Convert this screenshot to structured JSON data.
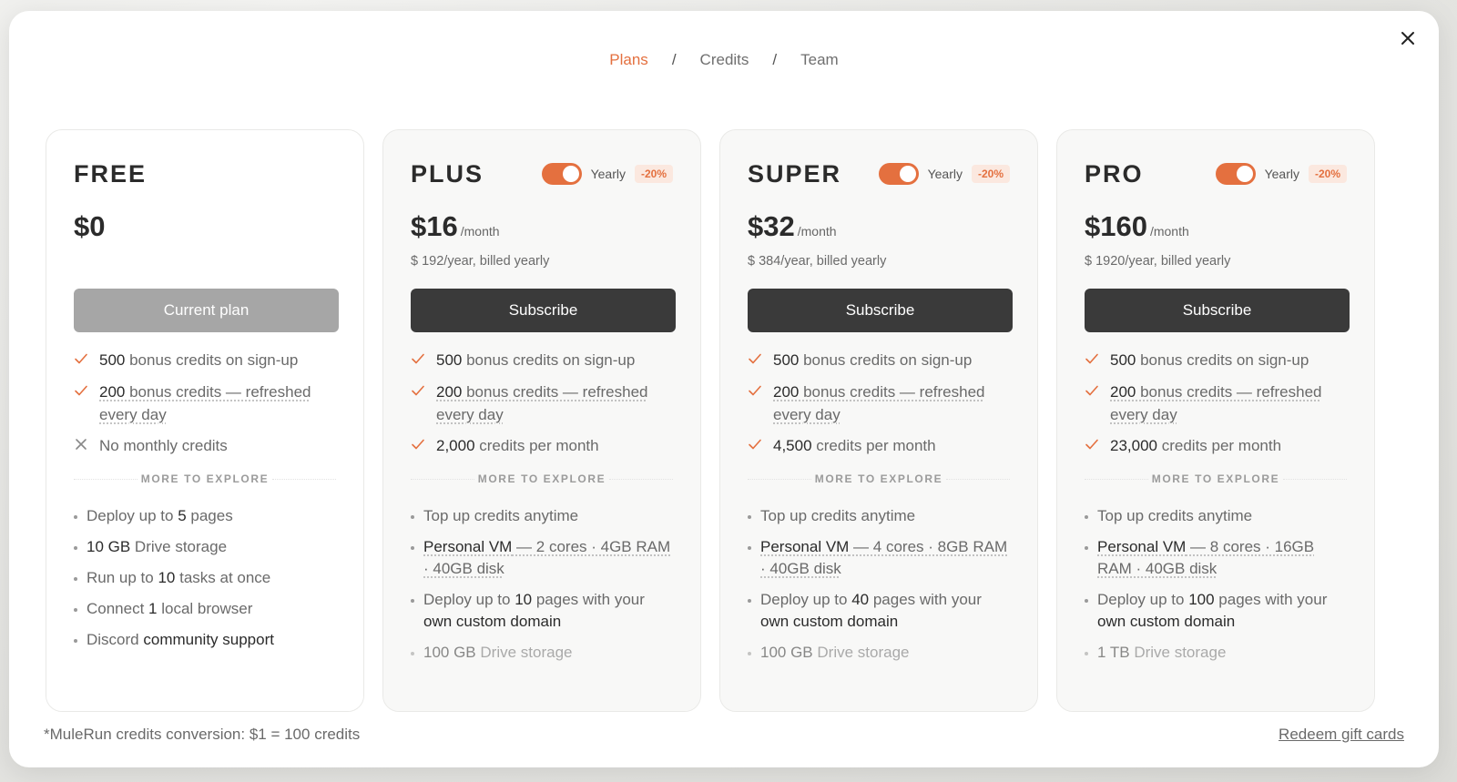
{
  "nav": {
    "tabs": [
      {
        "label": "Plans",
        "active": true
      },
      {
        "label": "Credits",
        "active": false
      },
      {
        "label": "Team",
        "active": false
      }
    ],
    "separator": "/"
  },
  "colors": {
    "accent": "#e4703f",
    "button_dark": "#3a3a3a",
    "button_disabled": "#a6a6a6"
  },
  "close_icon": "close-icon",
  "plans": [
    {
      "name": "FREE",
      "price": "$0",
      "per": "",
      "billed": "",
      "cta": "Current plan",
      "features": [
        {
          "icon": "check",
          "bold": "500",
          "text": " bonus credits on sign-up",
          "underline": false
        },
        {
          "icon": "check",
          "bold": "200",
          "text": " bonus credits — refreshed every day",
          "underline": true
        },
        {
          "icon": "cross",
          "bold": "",
          "text": "No monthly credits",
          "underline": false
        }
      ],
      "more_label": "MORE TO EXPLORE",
      "explore": [
        {
          "pre": "Deploy up to ",
          "bold": "5",
          "post": " pages"
        },
        {
          "pre": "",
          "bold": "10 GB",
          "post": " Drive storage"
        },
        {
          "pre": "Run up to ",
          "bold": "10",
          "post": " tasks at once"
        },
        {
          "pre": "Connect ",
          "bold": "1",
          "post": " local browser"
        },
        {
          "pre": "Discord ",
          "bold": "community support",
          "post": ""
        }
      ]
    },
    {
      "name": "PLUS",
      "billing_label": "Yearly",
      "discount": "-20%",
      "price": "$16",
      "per": "/month",
      "billed": "$ 192/year, billed yearly",
      "cta": "Subscribe",
      "features": [
        {
          "icon": "check",
          "bold": "500",
          "text": " bonus credits on sign-up",
          "underline": false
        },
        {
          "icon": "check",
          "bold": "200",
          "text": " bonus credits — refreshed every day",
          "underline": true
        },
        {
          "icon": "check",
          "bold": "2,000",
          "text": " credits per month",
          "underline": false
        }
      ],
      "more_label": "MORE TO EXPLORE",
      "explore": [
        {
          "pre": "Top up credits anytime",
          "bold": "",
          "post": ""
        },
        {
          "pre": "",
          "bold": "Personal VM",
          "post": " — 2 cores · 4GB RAM · 40GB disk",
          "underline": true
        },
        {
          "pre": "Deploy up to ",
          "bold": "10",
          "post": " pages with your ",
          "tail": "own custom domain"
        },
        {
          "pre": "",
          "bold": "100 GB",
          "post": " Drive storage",
          "faded": true
        }
      ]
    },
    {
      "name": "SUPER",
      "billing_label": "Yearly",
      "discount": "-20%",
      "price": "$32",
      "per": "/month",
      "billed": "$ 384/year, billed yearly",
      "cta": "Subscribe",
      "features": [
        {
          "icon": "check",
          "bold": "500",
          "text": " bonus credits on sign-up",
          "underline": false
        },
        {
          "icon": "check",
          "bold": "200",
          "text": " bonus credits — refreshed every day",
          "underline": true
        },
        {
          "icon": "check",
          "bold": "4,500",
          "text": " credits per month",
          "underline": false
        }
      ],
      "more_label": "MORE TO EXPLORE",
      "explore": [
        {
          "pre": "Top up credits anytime",
          "bold": "",
          "post": ""
        },
        {
          "pre": "",
          "bold": "Personal VM",
          "post": " — 4 cores · 8GB RAM · 40GB disk",
          "underline": true
        },
        {
          "pre": "Deploy up to ",
          "bold": "40",
          "post": " pages with your ",
          "tail": "own custom domain"
        },
        {
          "pre": "",
          "bold": "100 GB",
          "post": " Drive storage",
          "faded": true
        }
      ]
    },
    {
      "name": "PRO",
      "billing_label": "Yearly",
      "discount": "-20%",
      "price": "$160",
      "per": "/month",
      "billed": "$ 1920/year, billed yearly",
      "cta": "Subscribe",
      "features": [
        {
          "icon": "check",
          "bold": "500",
          "text": " bonus credits on sign-up",
          "underline": false
        },
        {
          "icon": "check",
          "bold": "200",
          "text": " bonus credits — refreshed every day",
          "underline": true
        },
        {
          "icon": "check",
          "bold": "23,000",
          "text": " credits per month",
          "underline": false
        }
      ],
      "more_label": "MORE TO EXPLORE",
      "explore": [
        {
          "pre": "Top up credits anytime",
          "bold": "",
          "post": ""
        },
        {
          "pre": "",
          "bold": "Personal VM",
          "post": " — 8 cores · 16GB RAM · 40GB disk",
          "underline": true
        },
        {
          "pre": "Deploy up to ",
          "bold": "100",
          "post": " pages with your ",
          "tail": "own custom domain"
        },
        {
          "pre": "",
          "bold": "1 TB",
          "post": " Drive storage",
          "faded": true
        }
      ]
    }
  ],
  "footer": {
    "note": "*MuleRun credits conversion: $1 = 100 credits",
    "redeem": "Redeem gift cards"
  }
}
